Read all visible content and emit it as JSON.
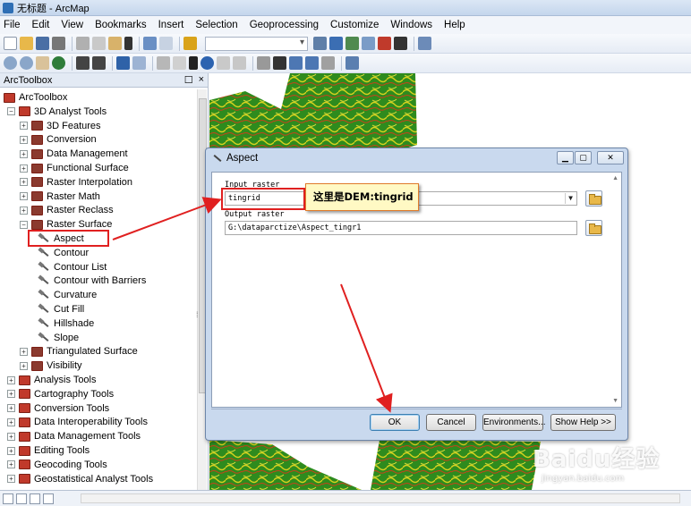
{
  "window": {
    "title": "无标题 - ArcMap"
  },
  "menubar": {
    "items": [
      "File",
      "Edit",
      "View",
      "Bookmarks",
      "Insert",
      "Selection",
      "Geoprocessing",
      "Customize",
      "Windows",
      "Help"
    ]
  },
  "toolbox": {
    "title": "ArcToolbox",
    "pin_glyph": "☐",
    "close_glyph": "×",
    "items": [
      {
        "label": "ArcToolbox",
        "depth": 0,
        "expander": "",
        "icon": "toolbox-icon"
      },
      {
        "label": "3D Analyst Tools",
        "depth": 1,
        "expander": "−",
        "icon": "toolbox-icon"
      },
      {
        "label": "3D Features",
        "depth": 2,
        "expander": "+",
        "icon": "toolset-icon"
      },
      {
        "label": "Conversion",
        "depth": 2,
        "expander": "+",
        "icon": "toolset-icon"
      },
      {
        "label": "Data Management",
        "depth": 2,
        "expander": "+",
        "icon": "toolset-icon"
      },
      {
        "label": "Functional Surface",
        "depth": 2,
        "expander": "+",
        "icon": "toolset-icon"
      },
      {
        "label": "Raster Interpolation",
        "depth": 2,
        "expander": "+",
        "icon": "toolset-icon"
      },
      {
        "label": "Raster Math",
        "depth": 2,
        "expander": "+",
        "icon": "toolset-icon"
      },
      {
        "label": "Raster Reclass",
        "depth": 2,
        "expander": "+",
        "icon": "toolset-icon"
      },
      {
        "label": "Raster Surface",
        "depth": 2,
        "expander": "−",
        "icon": "toolset-icon"
      },
      {
        "label": "Aspect",
        "depth": 3,
        "expander": "",
        "icon": "hammer-icon"
      },
      {
        "label": "Contour",
        "depth": 3,
        "expander": "",
        "icon": "hammer-icon"
      },
      {
        "label": "Contour List",
        "depth": 3,
        "expander": "",
        "icon": "hammer-icon"
      },
      {
        "label": "Contour with Barriers",
        "depth": 3,
        "expander": "",
        "icon": "hammer-icon"
      },
      {
        "label": "Curvature",
        "depth": 3,
        "expander": "",
        "icon": "hammer-icon"
      },
      {
        "label": "Cut Fill",
        "depth": 3,
        "expander": "",
        "icon": "hammer-icon"
      },
      {
        "label": "Hillshade",
        "depth": 3,
        "expander": "",
        "icon": "hammer-icon"
      },
      {
        "label": "Slope",
        "depth": 3,
        "expander": "",
        "icon": "hammer-icon"
      },
      {
        "label": "Triangulated Surface",
        "depth": 2,
        "expander": "+",
        "icon": "toolset-icon"
      },
      {
        "label": "Visibility",
        "depth": 2,
        "expander": "+",
        "icon": "toolset-icon"
      },
      {
        "label": "Analysis Tools",
        "depth": 1,
        "expander": "+",
        "icon": "toolbox-icon"
      },
      {
        "label": "Cartography Tools",
        "depth": 1,
        "expander": "+",
        "icon": "toolbox-icon"
      },
      {
        "label": "Conversion Tools",
        "depth": 1,
        "expander": "+",
        "icon": "toolbox-icon"
      },
      {
        "label": "Data Interoperability Tools",
        "depth": 1,
        "expander": "+",
        "icon": "toolbox-icon"
      },
      {
        "label": "Data Management Tools",
        "depth": 1,
        "expander": "+",
        "icon": "toolbox-icon"
      },
      {
        "label": "Editing Tools",
        "depth": 1,
        "expander": "+",
        "icon": "toolbox-icon"
      },
      {
        "label": "Geocoding Tools",
        "depth": 1,
        "expander": "+",
        "icon": "toolbox-icon"
      },
      {
        "label": "Geostatistical Analyst Tools",
        "depth": 1,
        "expander": "+",
        "icon": "toolbox-icon"
      }
    ]
  },
  "dialog": {
    "title": "Aspect",
    "input_raster_label": "Input raster",
    "input_raster_value": "tingrid",
    "output_raster_label": "Output raster",
    "output_raster_value": "G:\\dataparctize\\Aspect_tingr1",
    "buttons": {
      "ok": "OK",
      "cancel": "Cancel",
      "environments": "Environments...",
      "show_help": "Show Help >>"
    }
  },
  "annotation": {
    "callout_text": "这里是DEM:tingrid",
    "accent_color": "#e02020"
  },
  "watermark": {
    "brand": "Baidu经验",
    "url": "jingyan.baidu.com"
  }
}
